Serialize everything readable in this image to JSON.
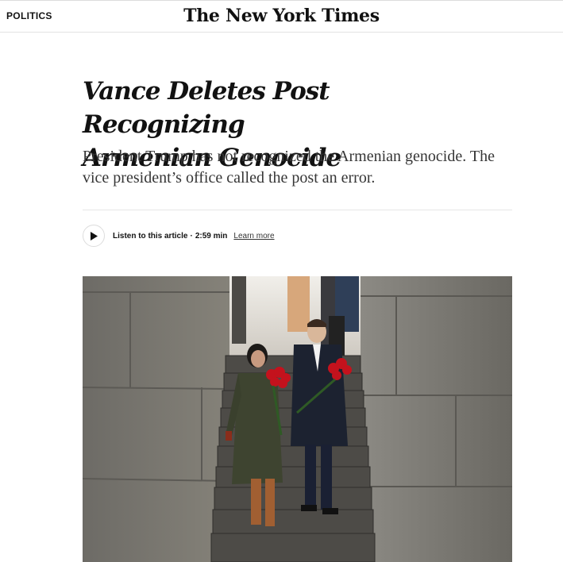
{
  "header": {
    "section": "POLITICS",
    "masthead": "The New York Times"
  },
  "article": {
    "headline_line1": "Vance Deletes Post Recognizing",
    "headline_line2": "Armenian Genocide",
    "summary": "President Trump has not recognized the Armenian genocide. The vice president’s office called the post an error."
  },
  "audio": {
    "listen_label": "Listen to this article",
    "separator": "·",
    "duration": "2:59 min",
    "learn_more": "Learn more",
    "icon": "play-icon"
  },
  "photo": {
    "icon": "article-photo"
  }
}
